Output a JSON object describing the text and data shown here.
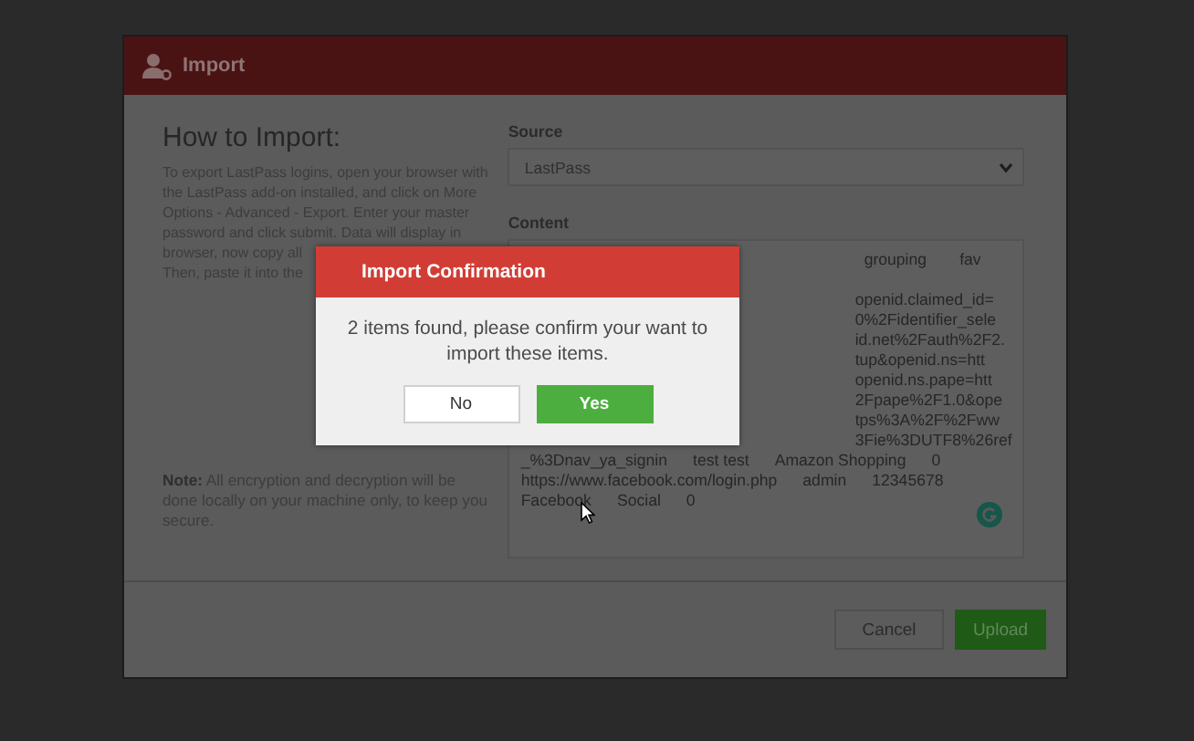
{
  "dialog": {
    "title": "Import",
    "heading": "How to Import:",
    "instructions": [
      "To export LastPass logins, open your browser with",
      "the LastPass add-on installed, and click on More",
      "Options - Advanced - Export. Enter your master",
      "password and click submit. Data will display in",
      "browser, now copy all",
      "Then, paste it into the"
    ],
    "note": "**Note:** All encryption and decryption will be done locally on your machine only, to keep you secure.",
    "source": {
      "label": "Source",
      "value": "LastPass"
    },
    "content": {
      "label": "Content",
      "covered_lines": [
        [
          "grouping",
          "fav"
        ],
        [
          "openid.claimed_id="
        ],
        [
          "0%2Fidentifier_sele"
        ],
        [
          "id.net%2Fauth%2F2."
        ],
        [
          "tup&openid.ns=htt"
        ],
        [
          "openid.ns.pape=htt"
        ],
        [
          "2Fpape%2F1.0&ope"
        ],
        [
          "tps%3A%2F%2Fww"
        ],
        [
          "3Fie%3DUTF8%26ref"
        ]
      ],
      "lines": [
        [
          "_%3Dnav_ya_signin",
          "test test",
          "Amazon Shopping",
          "0"
        ],
        [
          "https://www.facebook.com/login.php",
          "admin",
          "12345678"
        ],
        [
          "Facebook",
          "Social",
          "0"
        ]
      ]
    },
    "buttons": [
      {
        "label": "Cancel",
        "kind": "secondary"
      },
      {
        "label": "Upload",
        "kind": "primary"
      }
    ]
  },
  "confirmation": {
    "title": "Import Confirmation",
    "message": "2 items found, please confirm your want to import these items.",
    "buttons": [
      {
        "label": "No",
        "kind": "secondary"
      },
      {
        "label": "Yes",
        "kind": "primary"
      }
    ]
  }
}
